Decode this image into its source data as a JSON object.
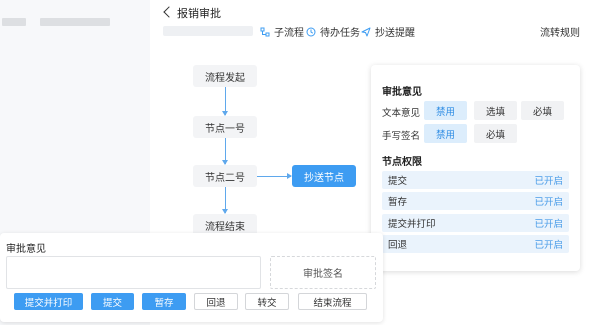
{
  "header": {
    "back_label": "报销审批",
    "tools": [
      {
        "label": "子流程",
        "icon": "subprocess-icon"
      },
      {
        "label": "待办任务",
        "icon": "clock-icon"
      },
      {
        "label": "抄送提醒",
        "icon": "send-icon"
      }
    ],
    "flow_rules": "流转规则"
  },
  "flow": {
    "nodes": [
      "流程发起",
      "节点一号",
      "节点二号",
      "流程结束"
    ],
    "cc_node": "抄送节点"
  },
  "panel": {
    "opinion_title": "审批意见",
    "text_opinion_label": "文本意见",
    "text_opinion_options": [
      "禁用",
      "选填",
      "必填"
    ],
    "handwrite_label": "手写签名",
    "handwrite_options": [
      "禁用",
      "必填"
    ],
    "permissions_title": "节点权限",
    "permissions": [
      {
        "name": "提交",
        "status": "已开启"
      },
      {
        "name": "暂存",
        "status": "已开启"
      },
      {
        "name": "提交并打印",
        "status": "已开启"
      },
      {
        "name": "回退",
        "status": "已开启"
      }
    ]
  },
  "card": {
    "title": "审批意见",
    "sign_placeholder": "审批签名",
    "buttons": [
      "提交并打印",
      "提交",
      "暂存",
      "回退",
      "转交",
      "结束流程"
    ]
  },
  "colors": {
    "accent": "#3d9cf2",
    "selected_bg": "#dcedfc",
    "permission_bg": "#eaf3fc"
  }
}
